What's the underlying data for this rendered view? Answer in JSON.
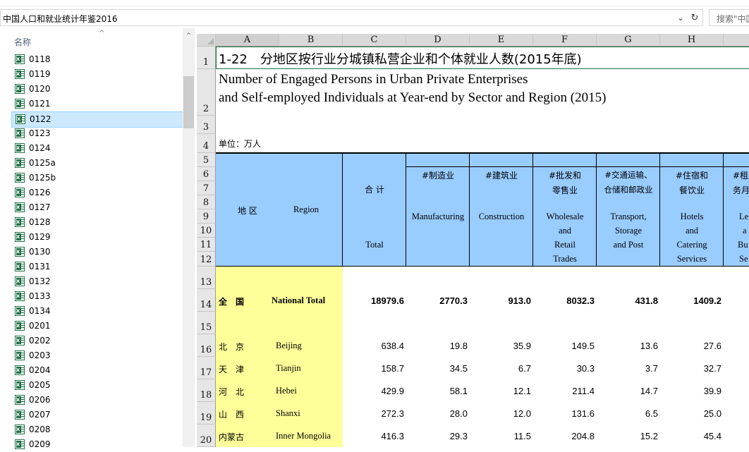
{
  "address_bar": {
    "path": "中国人口和就业统计年鉴2016"
  },
  "search": {
    "placeholder": "搜索\"中国"
  },
  "file_list": {
    "column_name": "名称",
    "items": [
      "0118",
      "0119",
      "0120",
      "0121",
      "0122",
      "0123",
      "0124",
      "0125a",
      "0125b",
      "0126",
      "0127",
      "0128",
      "0129",
      "0130",
      "0131",
      "0132",
      "0133",
      "0134",
      "0201",
      "0202",
      "0203",
      "0204",
      "0205",
      "0206",
      "0207",
      "0208",
      "0209"
    ],
    "selected": "0122"
  },
  "sheet": {
    "columns": [
      "A",
      "B",
      "C",
      "D",
      "E",
      "F",
      "G",
      "H"
    ],
    "rows": [
      "1",
      "2",
      "3",
      "4",
      "5",
      "6",
      "7",
      "8",
      "9",
      "10",
      "11",
      "12",
      "13",
      "14",
      "15",
      "16",
      "17",
      "18",
      "19",
      "20"
    ],
    "title_cn": "1-22　分地区按行业分城镇私营企业和个体就业人数(2015年底)",
    "title_en_line1": "Number of Engaged Persons in Urban Private Enterprises",
    "title_en_line2": "and Self-employed Individuals at Year-end by Sector and Region (2015)",
    "unit": "单位：万人",
    "header": {
      "region_cn": "地 区",
      "region_en": "Region",
      "total_cn": "合 计",
      "total_en": "Total",
      "manufacturing_cn": "#制造业",
      "manufacturing_en": "Manufacturing",
      "construction_cn": "#建筑业",
      "construction_en": "Construction",
      "wholesale_cn1": "#批发和",
      "wholesale_cn2": "零售业",
      "wholesale_en1": "Wholesale",
      "wholesale_en2": "and",
      "wholesale_en3": "Retail",
      "wholesale_en4": "Trades",
      "transport_cn1": "#交通运输、",
      "transport_cn2": "仓储和邮政业",
      "transport_en1": "Transport,",
      "transport_en2": "Storage",
      "transport_en3": "and Post",
      "hotels_cn1": "#住宿和",
      "hotels_cn2": "餐饮业",
      "hotels_en1": "Hotels",
      "hotels_en2": "and",
      "hotels_en3": "Catering",
      "hotels_en4": "Services",
      "leasing_cn1": "#租",
      "leasing_cn2": "务月",
      "leasing_en1": "Le",
      "leasing_en2": "a",
      "leasing_en3": "Bu",
      "leasing_en4": "Se"
    },
    "data": [
      {
        "cn": "全　国",
        "en": "National Total",
        "total": "18979.6",
        "manufacturing": "2770.3",
        "construction": "913.0",
        "wholesale": "8032.3",
        "transport": "431.8",
        "hotels": "1409.2"
      },
      {
        "cn": "北　京",
        "en": "Beijing",
        "total": "638.4",
        "manufacturing": "19.8",
        "construction": "35.9",
        "wholesale": "149.5",
        "transport": "13.6",
        "hotels": "27.6"
      },
      {
        "cn": "天　津",
        "en": "Tianjin",
        "total": "158.7",
        "manufacturing": "34.5",
        "construction": "6.7",
        "wholesale": "30.3",
        "transport": "3.7",
        "hotels": "32.7"
      },
      {
        "cn": "河　北",
        "en": "Hebei",
        "total": "429.9",
        "manufacturing": "58.1",
        "construction": "12.1",
        "wholesale": "211.4",
        "transport": "14.7",
        "hotels": "39.9"
      },
      {
        "cn": "山　西",
        "en": "Shanxi",
        "total": "272.3",
        "manufacturing": "28.0",
        "construction": "12.0",
        "wholesale": "131.6",
        "transport": "6.5",
        "hotels": "25.0"
      },
      {
        "cn": "内蒙古",
        "en": "Inner Mongolia",
        "total": "416.3",
        "manufacturing": "29.3",
        "construction": "11.5",
        "wholesale": "204.8",
        "transport": "15.2",
        "hotels": "45.4"
      }
    ]
  }
}
